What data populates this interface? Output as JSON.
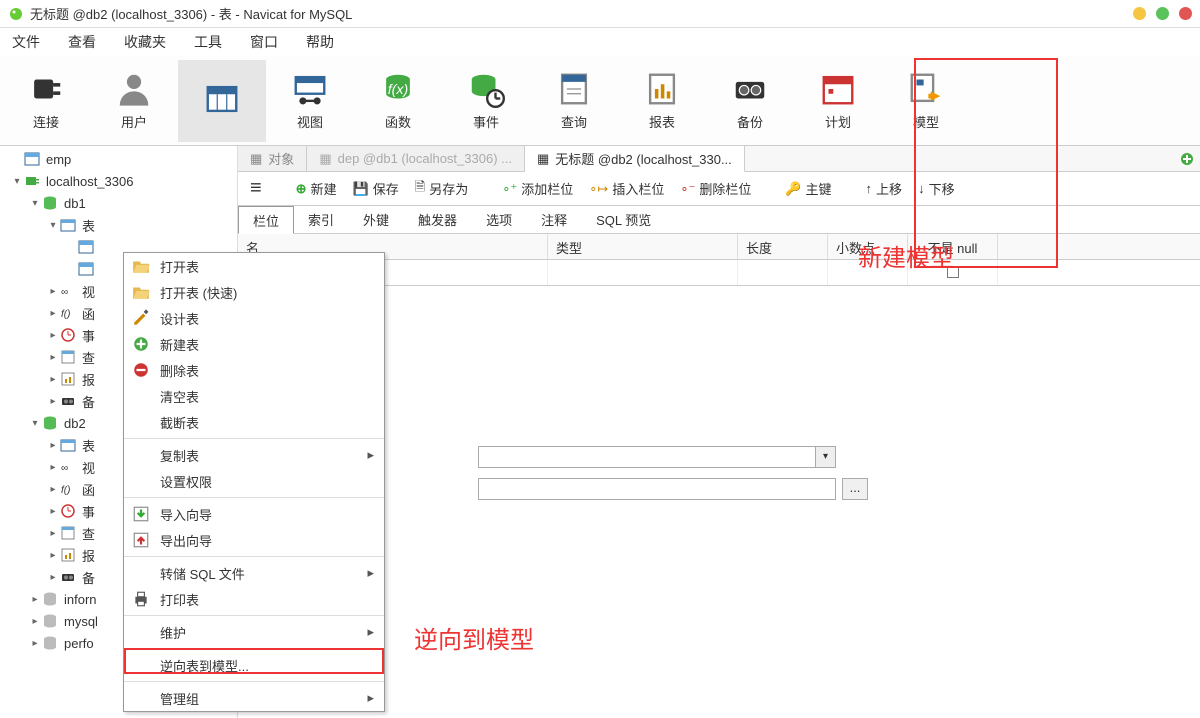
{
  "window": {
    "title": "无标题 @db2 (localhost_3306) - 表 - Navicat for MySQL"
  },
  "menu": {
    "items": [
      "文件",
      "查看",
      "收藏夹",
      "工具",
      "窗口",
      "帮助"
    ]
  },
  "toolbar": {
    "items": [
      {
        "label": "连接",
        "icon": "plug"
      },
      {
        "label": "用户",
        "icon": "user"
      },
      {
        "label": "",
        "icon": "table",
        "active": true
      },
      {
        "label": "视图",
        "icon": "view"
      },
      {
        "label": "函数",
        "icon": "fx"
      },
      {
        "label": "事件",
        "icon": "clock"
      },
      {
        "label": "查询",
        "icon": "query"
      },
      {
        "label": "报表",
        "icon": "report"
      },
      {
        "label": "备份",
        "icon": "backup"
      },
      {
        "label": "计划",
        "icon": "schedule"
      },
      {
        "label": "模型",
        "icon": "model"
      }
    ]
  },
  "sidebar": {
    "rows": [
      {
        "indent": 0,
        "caret": "",
        "icon": "tbl",
        "label": "emp"
      },
      {
        "indent": 0,
        "caret": "▾",
        "icon": "conn",
        "label": "localhost_3306"
      },
      {
        "indent": 1,
        "caret": "▾",
        "icon": "db",
        "label": "db1"
      },
      {
        "indent": 2,
        "caret": "▾",
        "icon": "folder",
        "label": "表"
      },
      {
        "indent": 3,
        "caret": "",
        "icon": "tbl",
        "label": ""
      },
      {
        "indent": 3,
        "caret": "",
        "icon": "tbl",
        "label": ""
      },
      {
        "indent": 2,
        "caret": "▸",
        "icon": "view",
        "label": "视"
      },
      {
        "indent": 2,
        "caret": "▸",
        "icon": "fx",
        "label": "函"
      },
      {
        "indent": 2,
        "caret": "▸",
        "icon": "evt",
        "label": "事"
      },
      {
        "indent": 2,
        "caret": "▸",
        "icon": "qry",
        "label": "查"
      },
      {
        "indent": 2,
        "caret": "▸",
        "icon": "rpt",
        "label": "报"
      },
      {
        "indent": 2,
        "caret": "▸",
        "icon": "bkp",
        "label": "备"
      },
      {
        "indent": 1,
        "caret": "▾",
        "icon": "db",
        "label": "db2"
      },
      {
        "indent": 2,
        "caret": "▸",
        "icon": "folder",
        "label": "表"
      },
      {
        "indent": 2,
        "caret": "▸",
        "icon": "view",
        "label": "视"
      },
      {
        "indent": 2,
        "caret": "▸",
        "icon": "fx",
        "label": "函"
      },
      {
        "indent": 2,
        "caret": "▸",
        "icon": "evt",
        "label": "事"
      },
      {
        "indent": 2,
        "caret": "▸",
        "icon": "qry",
        "label": "查"
      },
      {
        "indent": 2,
        "caret": "▸",
        "icon": "rpt",
        "label": "报"
      },
      {
        "indent": 2,
        "caret": "▸",
        "icon": "bkp",
        "label": "备"
      },
      {
        "indent": 1,
        "caret": "▸",
        "icon": "db-g",
        "label": "inforn"
      },
      {
        "indent": 1,
        "caret": "▸",
        "icon": "db-g",
        "label": "mysql"
      },
      {
        "indent": 1,
        "caret": "▸",
        "icon": "db-g",
        "label": "perfo"
      }
    ]
  },
  "tabs": {
    "items": [
      {
        "label": "对象",
        "icon": "obj",
        "active": false
      },
      {
        "label": "dep @db1 (localhost_3306) ...",
        "icon": "tbl",
        "active": false,
        "dim": true
      },
      {
        "label": "无标题 @db2 (localhost_330...",
        "icon": "edit",
        "active": true
      }
    ]
  },
  "actions": {
    "menu": "≡",
    "new": "新建",
    "save": "保存",
    "saveas": "另存为",
    "addcol": "添加栏位",
    "inscol": "插入栏位",
    "delcol": "删除栏位",
    "pk": "主键",
    "up": "上移",
    "down": "下移"
  },
  "subtabs": {
    "items": [
      "栏位",
      "索引",
      "外键",
      "触发器",
      "选项",
      "注释",
      "SQL 预览"
    ],
    "active": 0
  },
  "grid": {
    "headers": {
      "name": "名",
      "type": "类型",
      "len": "长度",
      "dec": "小数点",
      "null": "不是 null"
    }
  },
  "context_menu": {
    "items": [
      {
        "label": "打开表",
        "icon": "open"
      },
      {
        "label": "打开表 (快速)",
        "icon": "open"
      },
      {
        "label": "设计表",
        "icon": "design"
      },
      {
        "label": "新建表",
        "icon": "new"
      },
      {
        "label": "删除表",
        "icon": "del"
      },
      {
        "label": "清空表",
        "icon": ""
      },
      {
        "label": "截断表",
        "icon": ""
      },
      {
        "sep": true
      },
      {
        "label": "复制表",
        "icon": "",
        "sub": true
      },
      {
        "label": "设置权限",
        "icon": ""
      },
      {
        "sep": true
      },
      {
        "label": "导入向导",
        "icon": "import"
      },
      {
        "label": "导出向导",
        "icon": "export"
      },
      {
        "sep": true
      },
      {
        "label": "转储 SQL 文件",
        "icon": "",
        "sub": true
      },
      {
        "label": "打印表",
        "icon": "print"
      },
      {
        "sep": true
      },
      {
        "label": "维护",
        "icon": "",
        "sub": true
      },
      {
        "sep": true
      },
      {
        "label": "逆向表到模型...",
        "icon": "",
        "hl": true
      },
      {
        "sep": true
      },
      {
        "label": "管理组",
        "icon": "",
        "sub": true
      }
    ]
  },
  "annotations": {
    "new_model": "新建模型",
    "reverse": "逆向到模型"
  }
}
